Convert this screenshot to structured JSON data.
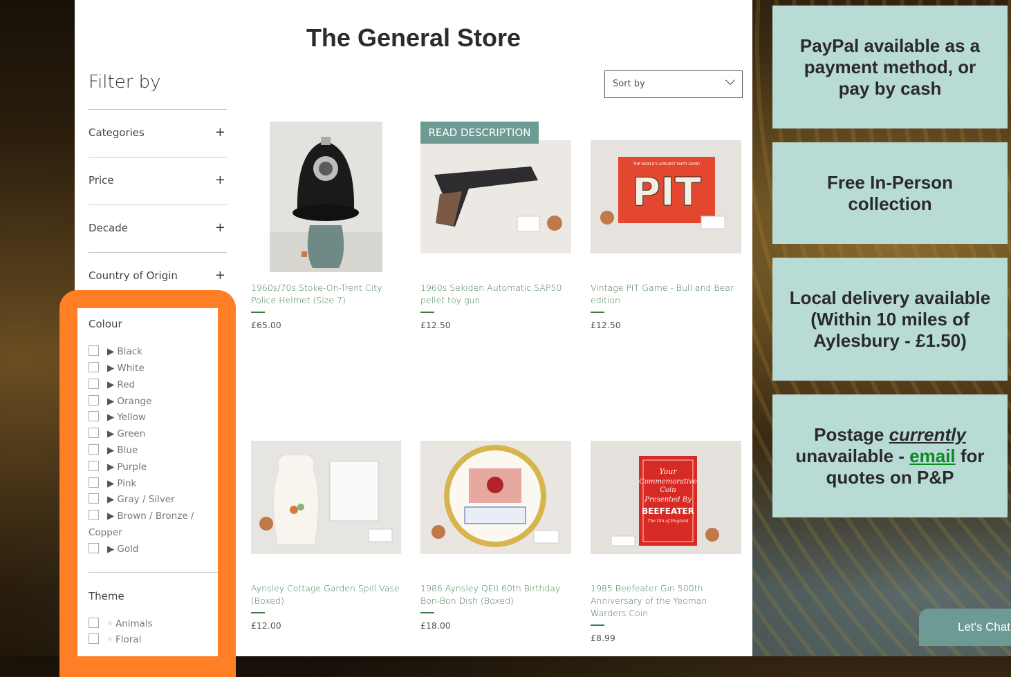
{
  "store": {
    "title": "The General Store"
  },
  "filter": {
    "title": "Filter by",
    "sections": [
      {
        "label": "Categories",
        "toggle": "+"
      },
      {
        "label": "Price",
        "toggle": "+"
      },
      {
        "label": "Decade",
        "toggle": "+"
      },
      {
        "label": "Country of Origin",
        "toggle": "+"
      }
    ],
    "colour": {
      "title": "Colour",
      "options": [
        "Black",
        "White",
        "Red",
        "Orange",
        "Yellow",
        "Green",
        "Blue",
        "Purple",
        "Pink",
        "Gray / Silver",
        "Brown / Bronze /",
        "Gold"
      ],
      "option_continuation": "Copper",
      "marker": "▶"
    },
    "theme": {
      "title": "Theme",
      "options": [
        "Animals",
        "Floral"
      ],
      "marker": "◦"
    }
  },
  "sort": {
    "label": "Sort by"
  },
  "ribbon": {
    "label": "READ DESCRIPTION"
  },
  "products": [
    {
      "name": "1960s/70s Stoke-On-Trent City Police Helmet (Size 7)",
      "price": "£65.00"
    },
    {
      "name": "1960s Sekiden Automatic SAP50 pellet toy gun",
      "price": "£12.50"
    },
    {
      "name": "Vintage PIT Game - Bull and Bear edition",
      "price": "£12.50"
    },
    {
      "name": "Aynsley Cottage Garden Spill Vase (Boxed)",
      "price": "£12.00"
    },
    {
      "name": "1986 Aynsley QEII 60th Birthday Bon-Bon Dish (Boxed)",
      "price": "£18.00"
    },
    {
      "name": "1985 Beefeater Gin 500th Anniversary of the Yeoman Warders Coin",
      "price": "£8.99"
    }
  ],
  "product_art": {
    "pit_title": "THE WORLD'S LIVELIEST PARTY GAME!",
    "pit_word": "PIT",
    "beefeater_line1": "Your",
    "beefeater_line2": "Commemorative",
    "beefeater_line3": "Coin",
    "beefeater_line4": "Presented By",
    "beefeater_brand": "BEEFEATER",
    "beefeater_sub": "The Gin of England"
  },
  "info_cards": [
    {
      "text": "PayPal available as a payment method, or pay by cash"
    },
    {
      "text": "Free In-Person collection"
    },
    {
      "text": "Local delivery available (Within 10 miles of Aylesbury - £1.50)"
    },
    {
      "pre": "Postage",
      "em": "currently",
      "mid": "unavailable -",
      "link": "email",
      "post": "for quotes on P&P"
    }
  ],
  "chat": {
    "label": "Let's Chat!"
  },
  "colors": {
    "accent_orange": "#ff7f27",
    "card_bg": "#b8dbd6",
    "ribbon_bg": "#6d9a92",
    "product_text": "#3d7a46",
    "link_green": "#0d8a1f"
  }
}
